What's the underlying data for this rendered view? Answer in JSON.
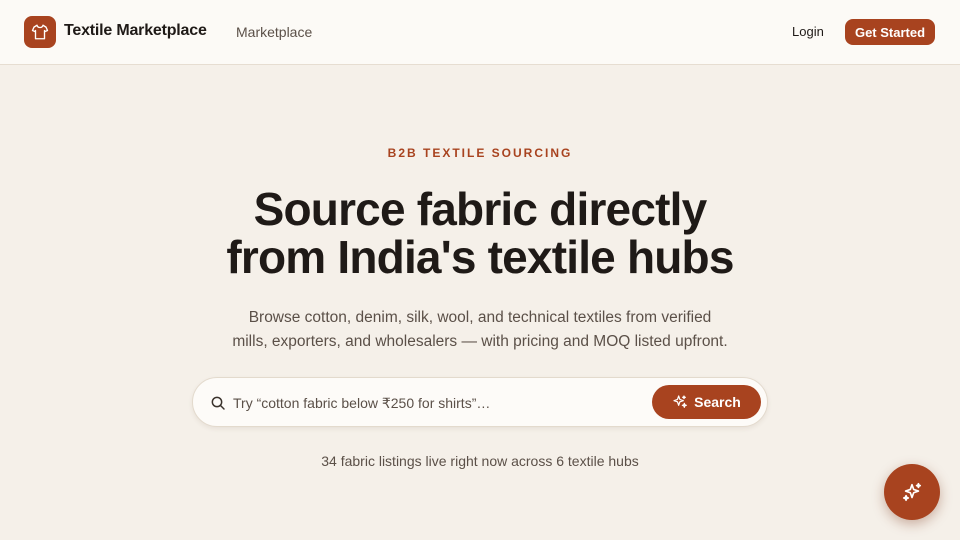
{
  "header": {
    "brand": "Textile Marketplace",
    "logo_icon": "tshirt-icon",
    "nav_link": "Marketplace",
    "login": "Login",
    "get_started": "Get Started"
  },
  "hero": {
    "eyebrow": "B2B TEXTILE SOURCING",
    "headline_line1": "Source fabric directly",
    "headline_line2": "from India's textile hubs",
    "subtitle_line1": "Browse cotton, denim, silk, wool, and technical textiles from verified",
    "subtitle_line2": "mills, exporters, and wholesalers — with pricing and MOQ listed upfront."
  },
  "search": {
    "icon": "search-icon",
    "placeholder": "Try “cotton fabric below ₹250 for shirts”…",
    "button_label": "Search",
    "button_icon": "sparkles-icon"
  },
  "status": {
    "listings_text": "34 fabric listings live right now across 6 textile hubs"
  },
  "fab": {
    "icon": "sparkles-icon"
  },
  "colors": {
    "accent": "#a8431f",
    "background": "#f5f0e9",
    "header_bg": "#fcfaf6",
    "text_primary": "#1f1a17",
    "text_muted": "#5b5048"
  }
}
